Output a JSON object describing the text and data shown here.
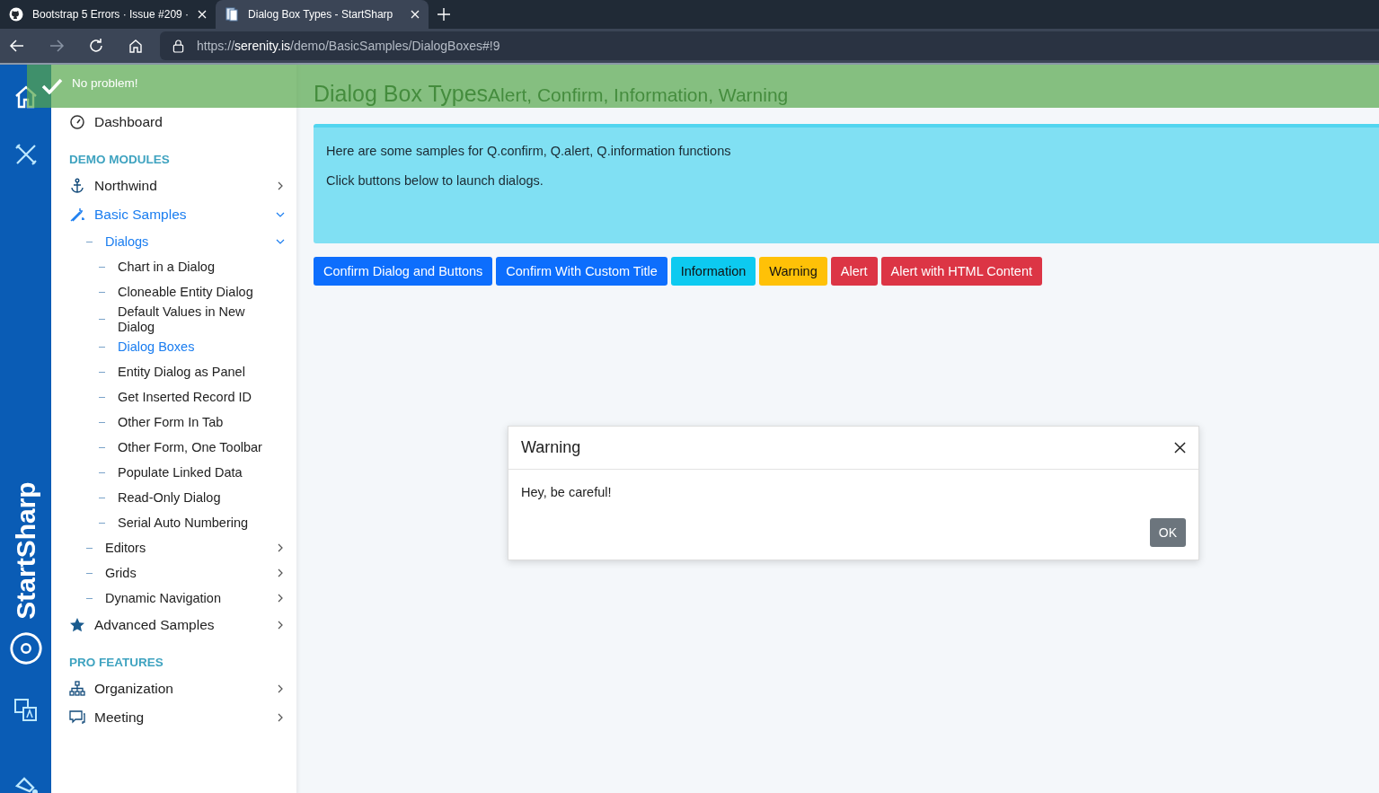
{
  "browser": {
    "tabs": [
      {
        "label": "Bootstrap 5 Errors · Issue #209 ·",
        "selected": false
      },
      {
        "label": "Dialog Box Types - StartSharp",
        "selected": true
      }
    ],
    "url": "https://**serenity.is**/demo/BasicSamples/DialogBoxes#!9"
  },
  "rail": {
    "brand": "StartSharp"
  },
  "sidebar": {
    "items": [
      {
        "kind": "link",
        "label": "Dashboard",
        "selected": false
      },
      {
        "kind": "heading",
        "label": "DEMO MODULES"
      },
      {
        "kind": "link",
        "label": "Northwind",
        "selected": false,
        "expanded": false
      },
      {
        "kind": "link",
        "label": "Basic Samples",
        "selected": true,
        "expanded": true,
        "children": [
          {
            "label": "Dialogs",
            "selected": true,
            "expanded": true,
            "children": [
              {
                "label": "Chart in a Dialog",
                "selected": false
              },
              {
                "label": "Cloneable Entity Dialog",
                "selected": false
              },
              {
                "label": "Default Values in New Dialog",
                "selected": false
              },
              {
                "label": "Dialog Boxes",
                "selected": true
              },
              {
                "label": "Entity Dialog as Panel",
                "selected": false
              },
              {
                "label": "Get Inserted Record ID",
                "selected": false
              },
              {
                "label": "Other Form In Tab",
                "selected": false
              },
              {
                "label": "Other Form, One Toolbar",
                "selected": false
              },
              {
                "label": "Populate Linked Data",
                "selected": false
              },
              {
                "label": "Read-Only Dialog",
                "selected": false
              },
              {
                "label": "Serial Auto Numbering",
                "selected": false
              }
            ]
          },
          {
            "label": "Editors",
            "selected": false,
            "expanded": false
          },
          {
            "label": "Grids",
            "selected": false,
            "expanded": false
          },
          {
            "label": "Dynamic Navigation",
            "selected": false,
            "expanded": false
          }
        ]
      },
      {
        "kind": "link",
        "label": "Advanced Samples",
        "selected": false,
        "expanded": false
      },
      {
        "kind": "heading",
        "label": "PRO FEATURES"
      },
      {
        "kind": "link",
        "label": "Organization",
        "selected": false,
        "expanded": false
      },
      {
        "kind": "link",
        "label": "Meeting",
        "selected": false,
        "expanded": false
      }
    ]
  },
  "toast": {
    "message": "No problem!"
  },
  "page": {
    "title": "Dialog Box Types",
    "subtitle": "Alert, Confirm, Information, Warning",
    "info": [
      "Here are some samples for Q.confirm, Q.alert, Q.information functions",
      "Click buttons below to launch dialogs."
    ],
    "buttons": [
      {
        "label": "Confirm Dialog and Buttons",
        "kind": "primary"
      },
      {
        "label": "Confirm With Custom Title",
        "kind": "primary"
      },
      {
        "label": "Information",
        "kind": "info"
      },
      {
        "label": "Warning",
        "kind": "warning"
      },
      {
        "label": "Alert",
        "kind": "danger"
      },
      {
        "label": "Alert with HTML Content",
        "kind": "danger"
      }
    ]
  },
  "dialog": {
    "title": "Warning",
    "message": "Hey, be careful!",
    "button": "OK"
  }
}
